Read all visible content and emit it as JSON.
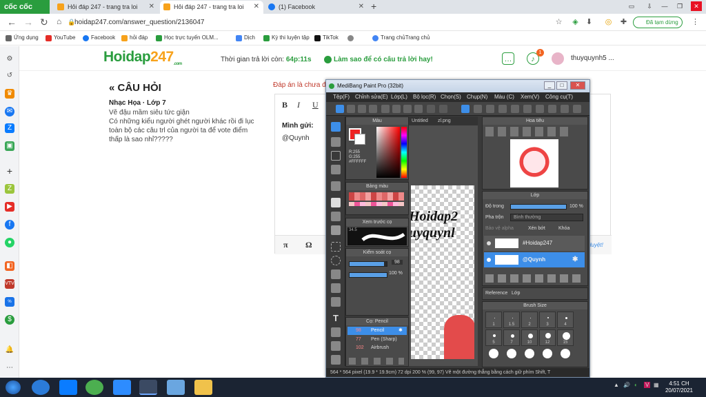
{
  "browser": {
    "brand": "cốc cốc",
    "tabs": [
      {
        "title": "Hỏi đáp 247 - trang tra loi",
        "color": "#f7a21b"
      },
      {
        "title": "Hỏi đáp 247 - trang tra loi",
        "color": "#f7a21b"
      },
      {
        "title": "(1) Facebook",
        "color": "#1877f2"
      }
    ],
    "new_tab": "+",
    "url": "hoidap247.com/answer_question/2136047",
    "profile_label": "Đã tạm dừng",
    "bookmarks": [
      {
        "label": "Ứng dụng",
        "color": "#666"
      },
      {
        "label": "YouTube",
        "color": "#e52d27"
      },
      {
        "label": "Facebook",
        "color": "#1877f2"
      },
      {
        "label": "hỏi đáp",
        "color": "#f7a21b"
      },
      {
        "label": "Học trực tuyến OLM...",
        "color": "#2a9d3e"
      },
      {
        "label": "Dịch",
        "color": "#4285f4"
      },
      {
        "label": "Kỳ thi luyện tập",
        "color": "#2a9d3e"
      },
      {
        "label": "TikTok",
        "color": "#111"
      },
      {
        "label": "",
        "color": "#888"
      },
      {
        "label": "Trang chủTrang chủ",
        "color": "#4285f4"
      }
    ]
  },
  "site": {
    "logo_main": "Hoidap",
    "logo_num": "247",
    "logo_sub": ".com",
    "timer_label": "Thời gian trả lời còn: ",
    "timer_value": "64p:11s",
    "howto": "Làm sao để có câu trả lời hay!",
    "notification_count": "1",
    "username": "thuyquynh5 ..."
  },
  "question": {
    "heading": "« CÂU HỎI",
    "meta": "Nhạc Họa · Lớp 7",
    "lines": [
      "Vẽ đậu mầm siêu tức giận",
      "Có những kiểu người ghét người khác rồi đi lục",
      "toàn bộ các câu trl của người ta để vote điểm",
      "thấp là sao nhỉ?????"
    ]
  },
  "answer": {
    "note": "Đáp án là chưa đ",
    "tools": [
      "B",
      "I",
      "U"
    ],
    "strong": "Mình gửi:",
    "user": "@Quynh",
    "footer_tools": [
      "π",
      "Ω"
    ],
    "hint": "duyệt!"
  },
  "medibang": {
    "title": "MediBang Paint Pro (32bit)",
    "menu": [
      "Tệp(F)",
      "Chỉnh sửa(E)",
      "Lớp(L)",
      "Bộ lọc(R)",
      "Chọn(S)",
      "Chụp(N)",
      "Màu (C)",
      "Xem(V)",
      "Công cụ(T)"
    ],
    "panels": {
      "color": "Màu",
      "color_values": [
        "R:255",
        "G:255",
        "#FFFFFF"
      ],
      "palette": "Bảng màu",
      "brush_preview": "Xem trước cọ",
      "brush_preview_size": "34.5",
      "brush_control": "Kiểm soát cọ",
      "brush_size_value": "98",
      "brush_opacity_value": "100 %",
      "brush_list_title": "Cọ: Pencil",
      "brushes": [
        {
          "size": "98",
          "name": "Pencil",
          "selected": true
        },
        {
          "size": "77",
          "name": "Pen (Sharp)",
          "selected": false
        },
        {
          "size": "102",
          "name": "Airbrush",
          "selected": false
        }
      ],
      "navigator": "Hoa tiêu",
      "layer_title": "Lớp",
      "opacity_label": "Độ trong",
      "opacity_value": "100 %",
      "blend_label": "Pha trộn",
      "blend_value": "Bình thường",
      "protect_alpha": "Bảo vệ alpha",
      "clipping": "Xén bớt",
      "lock": "Khóa",
      "layers": [
        {
          "name": "#Hoidap247",
          "selected": false
        },
        {
          "name": "@Quynh",
          "selected": true
        }
      ],
      "reference_tabs": [
        "Reference",
        "Lớp"
      ],
      "brush_size_title": "Brush Size",
      "brush_sizes": [
        "1",
        "1.5",
        "2",
        "3",
        "4",
        "5",
        "7",
        "10",
        "12",
        "15"
      ]
    },
    "doc_tabs": [
      "Untitled",
      "zl.png"
    ],
    "canvas_text": [
      "Hoidap2",
      "uyquynl"
    ],
    "status": "564 * 564 pixel  (19.9 * 19.9cm)  72 dpi  200 %  (99, 97)  Vẽ một đường thẳng bằng cách giữ phím Shift, T"
  },
  "taskbar": {
    "apps": [
      "ie",
      "zalo",
      "chrome",
      "zoom",
      "coccoc",
      "paint",
      "explorer"
    ],
    "time": "4:51 CH",
    "date": "20/07/2021"
  }
}
